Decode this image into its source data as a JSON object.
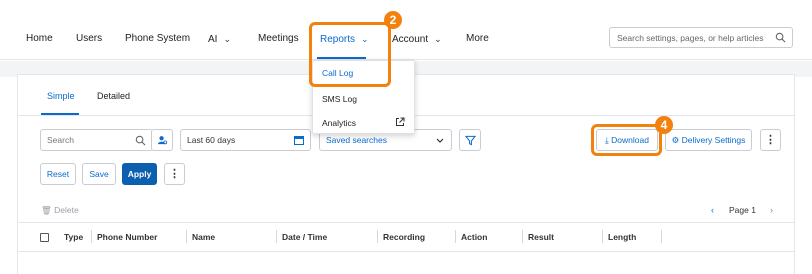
{
  "nav": {
    "items": [
      {
        "label": "Home",
        "has_chevron": false
      },
      {
        "label": "Users",
        "has_chevron": false
      },
      {
        "label": "Phone System",
        "has_chevron": false
      },
      {
        "label": "AI",
        "has_chevron": true
      },
      {
        "label": "Meetings",
        "has_chevron": false
      },
      {
        "label": "Reports",
        "has_chevron": true,
        "active": true
      },
      {
        "label": "Account",
        "has_chevron": true
      },
      {
        "label": "More",
        "has_chevron": false
      }
    ],
    "chevron": "⌄"
  },
  "global_search": {
    "placeholder": "Search settings, pages, or help articles"
  },
  "reports_menu": {
    "items": [
      {
        "label": "Call Log",
        "active": true
      },
      {
        "label": "SMS Log"
      },
      {
        "label": "Analytics",
        "external": true
      }
    ]
  },
  "tabs": [
    {
      "label": "Simple",
      "active": true
    },
    {
      "label": "Detailed"
    }
  ],
  "filters": {
    "search_placeholder": "Search",
    "date_range": "Last 60 days",
    "saved_searches": "Saved searches"
  },
  "actions": {
    "reset": "Reset",
    "save": "Save",
    "apply": "Apply",
    "download": "Download",
    "delivery_settings": "Delivery Settings",
    "more": "⋮"
  },
  "table": {
    "delete_label": "Delete",
    "pager": {
      "text": "Page 1",
      "prev": "‹",
      "next": "›"
    },
    "columns": [
      "Type",
      "Phone Number",
      "Name",
      "Date / Time",
      "Recording",
      "Action",
      "Result",
      "Length"
    ]
  },
  "steps": {
    "reports_step": "2",
    "download_step": "4"
  },
  "colors": {
    "accent": "#0b6bcb",
    "highlight": "#f2820d",
    "primary_button": "#0b5fae"
  }
}
